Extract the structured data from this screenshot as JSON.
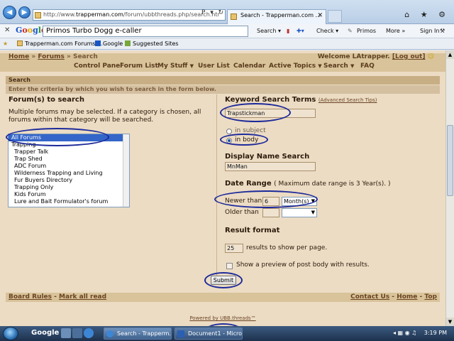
{
  "browser": {
    "url_prefix": "http://www.",
    "url_host": "trapperman.com",
    "url_rest": "/forum/ubbthreads.php/search.htr",
    "url_tools": "P ▾ ↻ ✕",
    "tab_title": "Search - Trapperman.com ...",
    "tab_close": "✕",
    "chrome_icons": "⌂ ★ ⚙",
    "win_controls": "─ ▢ ✕"
  },
  "google_toolbar": {
    "close": "✕",
    "logo": [
      "G",
      "o",
      "o",
      "g",
      "l",
      "e"
    ],
    "search_value": "Primos Turbo Dogg e-caller",
    "search_btn": "Search ▾",
    "check_btn": "Check ▾",
    "primos": "Primos",
    "more": "More »",
    "sign_in": "Sign In"
  },
  "favorites": {
    "items": [
      "Trapperman.com Forums ...",
      "Google",
      "Suggested Sites"
    ]
  },
  "forum": {
    "breadcrumb": {
      "home": "Home",
      "sep": "»",
      "forums": "Forums",
      "current": "Search"
    },
    "welcome_prefix": "Welcome LAtrapper.",
    "logout": "[Log out]",
    "menu": [
      {
        "label": "Control Panel",
        "caret": ""
      },
      {
        "label": "Forum List",
        "caret": ""
      },
      {
        "label": "My Stuff",
        "caret": "▼"
      },
      {
        "label": "User List",
        "caret": ""
      },
      {
        "label": "Calendar",
        "caret": ""
      },
      {
        "label": "Active Topics",
        "caret": "▼"
      },
      {
        "label": "Search",
        "caret": "▼"
      },
      {
        "label": "FAQ",
        "caret": ""
      }
    ],
    "search_header": "Search",
    "search_sub": "Enter the criteria by which you wish to search in the form below.",
    "left": {
      "title": "Forum(s) to search",
      "desc": "Multiple forums may be selected. If a category is chosen, all forums within that category will be searched.",
      "forums": [
        {
          "name": "All Forums",
          "selected": true,
          "cat": true
        },
        {
          "name": "Trapping",
          "selected": false,
          "cat": true
        },
        {
          "name": "Trapper Talk",
          "selected": false,
          "cat": false
        },
        {
          "name": "Trap Shed",
          "selected": false,
          "cat": false
        },
        {
          "name": "ADC Forum",
          "selected": false,
          "cat": false
        },
        {
          "name": "Wilderness Trapping and Living",
          "selected": false,
          "cat": false
        },
        {
          "name": "Fur Buyers Directory",
          "selected": false,
          "cat": false
        },
        {
          "name": "Trapping Only",
          "selected": false,
          "cat": false
        },
        {
          "name": "Kids Forum",
          "selected": false,
          "cat": false
        },
        {
          "name": "Lure and Bait Formulator's forum",
          "selected": false,
          "cat": false
        }
      ]
    },
    "right": {
      "keyword_title": "Keyword Search Terms",
      "advanced_link": "(Advanced Search Tips)",
      "keyword_value": "Trapstickman",
      "in_subject": "in subject",
      "in_body": "in body",
      "selected_scope": "in body",
      "display_name_title": "Display Name Search",
      "display_name_value": "MnMan",
      "date_range_title": "Date Range",
      "date_range_note": "( Maximum date range is 3 Year(s). )",
      "newer_than": "Newer than",
      "newer_value": "6",
      "newer_unit": "Month(s)",
      "older_than": "Older than",
      "older_value": "",
      "older_unit": "",
      "result_format_title": "Result format",
      "per_page_value": "25",
      "per_page_label": "results to show per page.",
      "preview_label": "Show a preview of post body with results."
    },
    "submit": "Submit",
    "footer": {
      "board_rules": "Board Rules",
      "mark_read": "Mark all read",
      "contact": "Contact Us",
      "home": "Home",
      "top": "Top",
      "sep": "-"
    },
    "powered_by": "Powered by UBB.threads™"
  },
  "taskbar": {
    "google": "Google",
    "buttons": [
      "Search - Trapperm...",
      "Document1 - Micro..."
    ],
    "clock": "3:19 PM"
  },
  "colors": {
    "page_bg": "#ecdcc4",
    "bar_bg": "#d8c39a",
    "link": "#6b4423",
    "annotation": "#1d2a9a",
    "selection": "#3465c8"
  }
}
